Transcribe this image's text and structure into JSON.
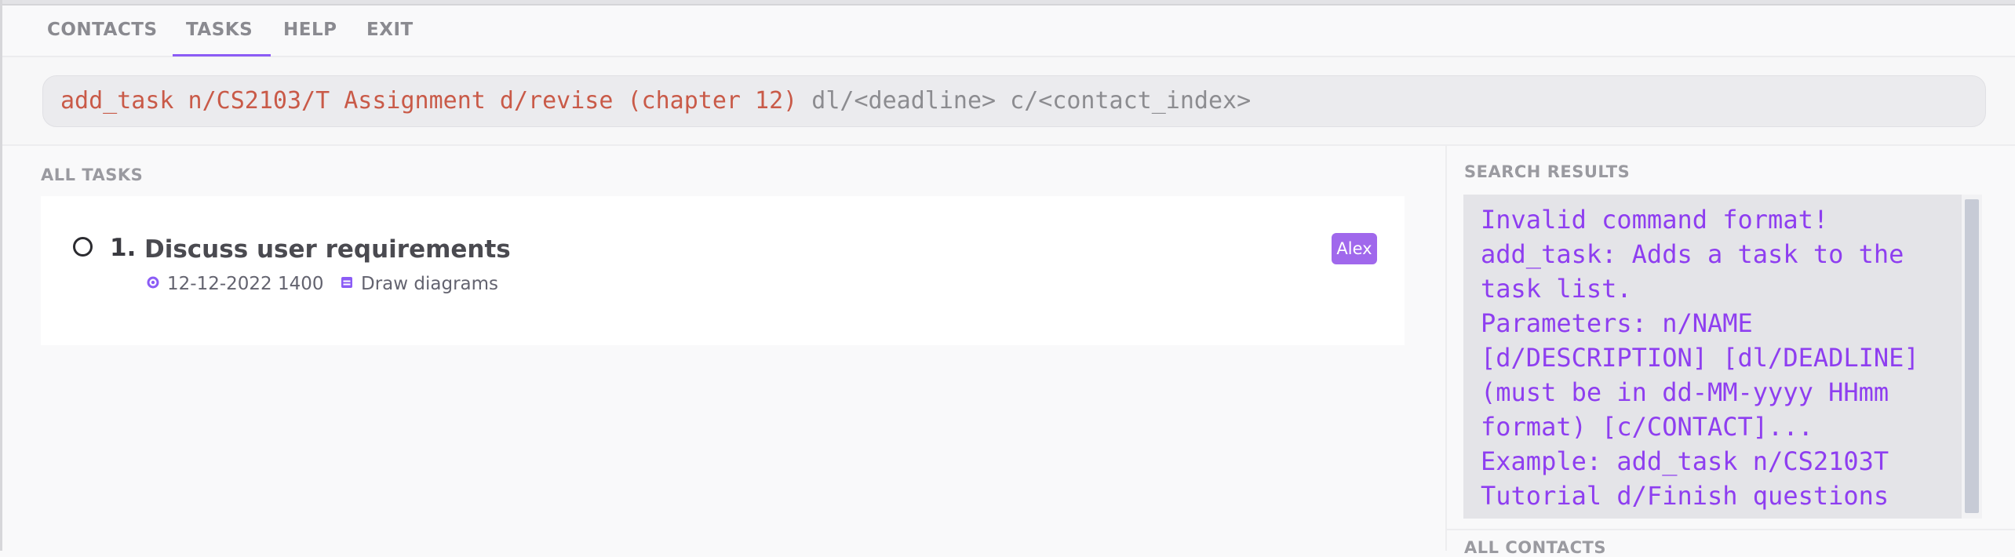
{
  "nav": {
    "tabs": [
      {
        "label": "CONTACTS"
      },
      {
        "label": "TASKS",
        "active": true
      },
      {
        "label": "HELP"
      },
      {
        "label": "EXIT"
      }
    ]
  },
  "command": {
    "typed": "add_task n/CS2103/T Assignment d/revise (chapter 12)",
    "hint": " dl/<deadline> c/<contact_index>"
  },
  "tasks_panel": {
    "title": "ALL TASKS",
    "tasks": [
      {
        "index": "1.",
        "name": "Discuss user requirements",
        "deadline": "12-12-2022 1400",
        "description": "Draw diagrams",
        "contact": "Alex",
        "completed": false
      }
    ]
  },
  "search_results": {
    "title": "SEARCH RESULTS",
    "text": "Invalid command format!\nadd_task: Adds a task to the task list.\nParameters: n/NAME [d/DESCRIPTION] [dl/DEADLINE] (must be in dd-MM-yyyy HHmm format) [c/CONTACT]...\nExample: add_task n/CS2103T Tutorial d/Finish questions"
  },
  "contacts_panel": {
    "title": "ALL CONTACTS"
  },
  "colors": {
    "accent": "#8b5cf6",
    "command_typed": "#c95a48",
    "command_hint": "#8c8c90",
    "result_text": "#8e3ef0",
    "badge": "#a068ec"
  },
  "icons": {
    "deadline": "clock-icon",
    "description": "notes-icon",
    "checkbox": "circle-checkbox-icon"
  }
}
